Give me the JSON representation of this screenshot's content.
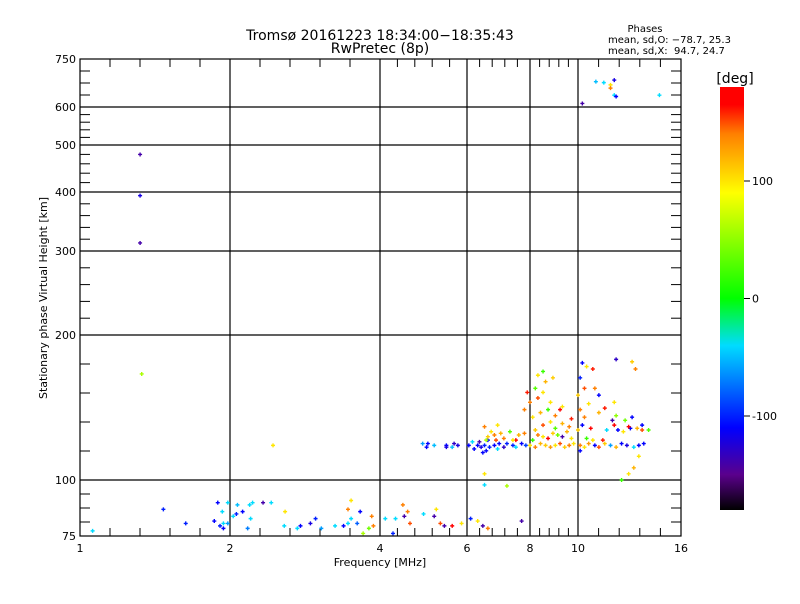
{
  "chart_data": {
    "type": "scatter",
    "title": "Tromsø 20161223 18:34:00−18:35:43",
    "subtitle": "RwPretec (8p)",
    "xlabel": "Frequency [MHz]",
    "ylabel": "Stationary phase Virtual Height [km]",
    "xscale": "log",
    "yscale": "log",
    "xlim": [
      1,
      16
    ],
    "ylim": [
      75,
      750
    ],
    "xticks": [
      "1",
      "2",
      "4",
      "6",
      "8",
      "10",
      "16"
    ],
    "yticks": [
      "75",
      "100",
      "200",
      "300",
      "400",
      "500",
      "600",
      "750"
    ],
    "grid": true,
    "legend": {
      "title": "Phases",
      "lines": [
        "mean, sd,O: −78.7, 25.3",
        "mean, sd,X:  94.7, 24.7"
      ],
      "placement": "top-right"
    },
    "colorbar": {
      "label": "[deg]",
      "range": [
        -180,
        180
      ],
      "ticks": [
        "100",
        "0",
        "-100"
      ],
      "colormap": "rainbow-black"
    },
    "point_fields": [
      "frequency_MHz",
      "height_km",
      "phase_deg"
    ],
    "points": [
      [
        1.32,
        478,
        -140
      ],
      [
        1.32,
        393,
        -120
      ],
      [
        1.32,
        312,
        -140
      ],
      [
        1.33,
        166,
        60
      ],
      [
        2.44,
        118,
        100
      ],
      [
        10.85,
        675,
        -50
      ],
      [
        11.25,
        672,
        -40
      ],
      [
        11.8,
        680,
        -120
      ],
      [
        11.6,
        665,
        100
      ],
      [
        11.6,
        655,
        140
      ],
      [
        11.8,
        634,
        -40
      ],
      [
        11.9,
        630,
        -110
      ],
      [
        10.2,
        610,
        -140
      ],
      [
        14.5,
        634,
        -40
      ],
      [
        1.06,
        77,
        -40
      ],
      [
        1.47,
        86,
        -100
      ],
      [
        1.63,
        80,
        -100
      ],
      [
        1.89,
        89,
        -110
      ],
      [
        1.98,
        89,
        -40
      ],
      [
        1.93,
        85,
        -40
      ],
      [
        1.94,
        80,
        -40
      ],
      [
        1.91,
        79,
        -100
      ],
      [
        1.86,
        81,
        -110
      ],
      [
        1.94,
        78,
        -110
      ],
      [
        1.98,
        80,
        -60
      ],
      [
        2.03,
        83,
        -40
      ],
      [
        2.06,
        84,
        -100
      ],
      [
        2.07,
        88,
        -50
      ],
      [
        2.12,
        85,
        -110
      ],
      [
        2.19,
        88,
        -40
      ],
      [
        2.17,
        78,
        -70
      ],
      [
        2.2,
        82,
        -40
      ],
      [
        2.22,
        89,
        -40
      ],
      [
        2.33,
        89,
        -140
      ],
      [
        2.42,
        89,
        -40
      ],
      [
        2.58,
        85,
        100
      ],
      [
        2.57,
        79,
        -40
      ],
      [
        2.73,
        78,
        -40
      ],
      [
        2.77,
        79,
        -110
      ],
      [
        2.9,
        80,
        -120
      ],
      [
        2.97,
        82,
        -100
      ],
      [
        3.05,
        78,
        -60
      ],
      [
        3.25,
        79,
        -40
      ],
      [
        3.38,
        79,
        -110
      ],
      [
        3.45,
        80,
        -40
      ],
      [
        3.6,
        80,
        -80
      ],
      [
        3.65,
        85,
        -110
      ],
      [
        3.45,
        86,
        140
      ],
      [
        3.5,
        90,
        100
      ],
      [
        3.5,
        82,
        -40
      ],
      [
        3.8,
        78,
        40
      ],
      [
        3.7,
        76,
        60
      ],
      [
        3.85,
        83,
        140
      ],
      [
        3.88,
        79,
        140
      ],
      [
        4.1,
        82,
        -40
      ],
      [
        4.25,
        76,
        -100
      ],
      [
        4.3,
        82,
        -40
      ],
      [
        4.48,
        83,
        -140
      ],
      [
        4.45,
        88,
        140
      ],
      [
        4.55,
        85,
        140
      ],
      [
        4.6,
        80,
        150
      ],
      [
        4.9,
        84,
        -40
      ],
      [
        5.15,
        83,
        -140
      ],
      [
        5.2,
        86,
        100
      ],
      [
        5.3,
        80,
        150
      ],
      [
        5.4,
        79,
        -140
      ],
      [
        5.6,
        79,
        170
      ],
      [
        5.85,
        80,
        100
      ],
      [
        6.1,
        82,
        -100
      ],
      [
        6.3,
        81,
        100
      ],
      [
        6.45,
        79,
        -140
      ],
      [
        6.6,
        78,
        140
      ],
      [
        7.7,
        81,
        -140
      ],
      [
        6.5,
        103,
        100
      ],
      [
        6.5,
        97.5,
        -40
      ],
      [
        7.2,
        97,
        60
      ],
      [
        12.2,
        100,
        20
      ],
      [
        12.6,
        103,
        100
      ],
      [
        4.88,
        119,
        -60
      ],
      [
        4.97,
        117,
        -110
      ],
      [
        5.0,
        119,
        -110
      ],
      [
        5.15,
        118,
        -50
      ],
      [
        5.45,
        118,
        -110
      ],
      [
        5.45,
        117,
        -120
      ],
      [
        5.6,
        117,
        -50
      ],
      [
        5.65,
        119,
        -130
      ],
      [
        5.75,
        118,
        -120
      ],
      [
        6.05,
        118,
        -110
      ],
      [
        6.15,
        120,
        -40
      ],
      [
        6.2,
        116,
        -110
      ],
      [
        6.3,
        118,
        -110
      ],
      [
        6.4,
        117,
        -120
      ],
      [
        6.35,
        120,
        -140
      ],
      [
        6.5,
        118,
        -100
      ],
      [
        6.55,
        115,
        -110
      ],
      [
        6.65,
        117,
        -100
      ],
      [
        6.45,
        114,
        -110
      ],
      [
        6.6,
        121,
        -110
      ],
      [
        6.8,
        118,
        -110
      ],
      [
        6.9,
        116,
        -40
      ],
      [
        6.95,
        119,
        -110
      ],
      [
        7.1,
        117,
        -130
      ],
      [
        7.2,
        119,
        -100
      ],
      [
        7.4,
        118,
        -100
      ],
      [
        7.5,
        117,
        -40
      ],
      [
        7.7,
        119,
        -110
      ],
      [
        7.85,
        118,
        -90
      ],
      [
        6.6,
        123,
        110
      ],
      [
        6.8,
        124,
        140
      ],
      [
        6.7,
        126,
        100
      ],
      [
        7.0,
        125,
        120
      ],
      [
        6.5,
        129,
        140
      ],
      [
        6.9,
        130,
        100
      ],
      [
        7.3,
        126,
        30
      ],
      [
        7.6,
        124,
        120
      ],
      [
        7.8,
        125,
        140
      ],
      [
        7.5,
        121,
        170
      ],
      [
        7.1,
        122,
        140
      ],
      [
        6.55,
        121,
        60
      ],
      [
        6.85,
        121,
        150
      ],
      [
        7.4,
        121,
        100
      ],
      [
        8.0,
        118,
        100
      ],
      [
        8.2,
        117,
        140
      ],
      [
        8.4,
        119,
        120
      ],
      [
        8.6,
        118,
        110
      ],
      [
        8.8,
        117,
        130
      ],
      [
        9.0,
        118,
        100
      ],
      [
        9.2,
        119,
        150
      ],
      [
        9.4,
        117,
        110
      ],
      [
        9.6,
        118,
        140
      ],
      [
        9.8,
        119,
        100
      ],
      [
        8.1,
        121,
        20
      ],
      [
        8.3,
        124,
        140
      ],
      [
        8.5,
        123,
        100
      ],
      [
        8.7,
        122,
        170
      ],
      [
        8.9,
        125,
        110
      ],
      [
        9.1,
        124,
        40
      ],
      [
        9.3,
        123,
        -140
      ],
      [
        9.5,
        126,
        120
      ],
      [
        9.7,
        122,
        100
      ],
      [
        8.2,
        127,
        110
      ],
      [
        8.5,
        130,
        150
      ],
      [
        8.8,
        132,
        100
      ],
      [
        9.0,
        128,
        30
      ],
      [
        9.3,
        131,
        120
      ],
      [
        9.6,
        129,
        140
      ],
      [
        8.1,
        135,
        100
      ],
      [
        8.4,
        138,
        120
      ],
      [
        8.7,
        140,
        20
      ],
      [
        9.0,
        136,
        140
      ],
      [
        9.3,
        142,
        100
      ],
      [
        9.7,
        134,
        160
      ],
      [
        8.0,
        145,
        140
      ],
      [
        8.3,
        148,
        150
      ],
      [
        8.5,
        152,
        100
      ],
      [
        8.2,
        155,
        30
      ],
      [
        8.6,
        160,
        120
      ],
      [
        8.3,
        165,
        100
      ],
      [
        8.5,
        168,
        20
      ],
      [
        8.9,
        163,
        110
      ],
      [
        8.8,
        145,
        100
      ],
      [
        9.2,
        140,
        170
      ],
      [
        7.9,
        152,
        160
      ],
      [
        7.8,
        140,
        140
      ],
      [
        10.1,
        118,
        140
      ],
      [
        10.3,
        117,
        100
      ],
      [
        10.5,
        119,
        130
      ],
      [
        10.8,
        118,
        -110
      ],
      [
        11.0,
        117,
        150
      ],
      [
        11.3,
        119,
        110
      ],
      [
        11.6,
        118,
        -60
      ],
      [
        11.9,
        117,
        120
      ],
      [
        12.2,
        119,
        -110
      ],
      [
        12.5,
        118,
        -120
      ],
      [
        12.9,
        117,
        -40
      ],
      [
        13.2,
        118,
        -110
      ],
      [
        13.5,
        119,
        -110
      ],
      [
        10.1,
        115,
        -110
      ],
      [
        10.4,
        122,
        20
      ],
      [
        10.7,
        121,
        100
      ],
      [
        11.2,
        121,
        160
      ],
      [
        10.0,
        127,
        110
      ],
      [
        10.2,
        130,
        -110
      ],
      [
        10.6,
        128,
        170
      ],
      [
        11.4,
        127,
        -40
      ],
      [
        12.0,
        127,
        -110
      ],
      [
        12.3,
        126,
        100
      ],
      [
        12.7,
        128,
        -110
      ],
      [
        13.1,
        128,
        120
      ],
      [
        13.4,
        127,
        150
      ],
      [
        13.8,
        127,
        30
      ],
      [
        12.6,
        129,
        170
      ],
      [
        11.8,
        130,
        170
      ],
      [
        10.3,
        135,
        140
      ],
      [
        10.1,
        140,
        140
      ],
      [
        10.5,
        144,
        100
      ],
      [
        11.0,
        138,
        120
      ],
      [
        11.3,
        141,
        160
      ],
      [
        11.7,
        133,
        -140
      ],
      [
        11.9,
        136,
        50
      ],
      [
        10.0,
        150,
        110
      ],
      [
        10.3,
        155,
        150
      ],
      [
        10.1,
        163,
        -100
      ],
      [
        10.4,
        172,
        100
      ],
      [
        10.7,
        170,
        160
      ],
      [
        10.8,
        155,
        140
      ],
      [
        10.2,
        175,
        -110
      ],
      [
        11.9,
        178,
        -130
      ],
      [
        12.8,
        176,
        110
      ],
      [
        13.0,
        170,
        140
      ],
      [
        11.0,
        150,
        -110
      ],
      [
        11.8,
        145,
        100
      ],
      [
        12.4,
        133,
        40
      ],
      [
        12.8,
        135,
        -110
      ],
      [
        13.4,
        130,
        -110
      ],
      [
        13.2,
        112,
        100
      ],
      [
        12.9,
        106,
        120
      ]
    ]
  }
}
